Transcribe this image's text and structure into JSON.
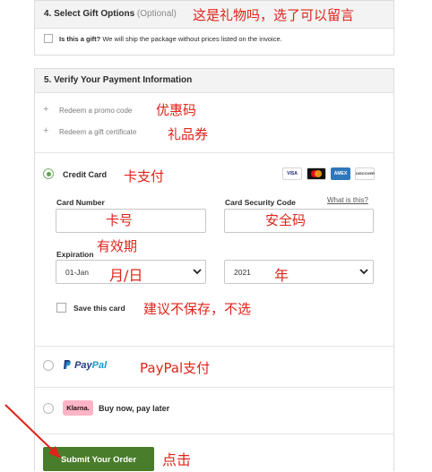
{
  "gift": {
    "heading": "4. Select Gift Options",
    "optional": "(Optional)",
    "annotation": "这是礼物吗，选了可以留言",
    "question": "Is this a gift?",
    "description": " We will ship the package without prices listed on the invoice."
  },
  "payment": {
    "heading": "5. Verify Your Payment Information",
    "promo_label": "Redeem a promo code",
    "promo_annotation": "优惠码",
    "gift_cert_label": "Redeem a gift certificate",
    "gift_cert_annotation": "礼品券",
    "credit_card_label": "Credit Card",
    "credit_card_annotation": "卡支付",
    "card_badges": [
      "VISA",
      "",
      "AMEX",
      "DISCOVER"
    ],
    "card_number_label": "Card Number",
    "card_number_annotation": "卡号",
    "security_code_label": "Card Security Code",
    "what_is_this": "What is this?",
    "security_code_annotation": "安全码",
    "expiration_label": "Expiration",
    "expiration_annotation": "有效期",
    "month_value": "01-Jan",
    "month_annotation": "月/日",
    "year_value": "2021",
    "year_annotation": "年",
    "save_card_label": "Save this card",
    "save_card_annotation": "建议不保存，不选",
    "paypal_brand_1": "Pay",
    "paypal_brand_2": "Pal",
    "paypal_annotation": "PayPal支付",
    "klarna_brand": "Klarna.",
    "klarna_label": "Buy now, pay later",
    "submit_label": "Submit Your Order",
    "submit_annotation": "点击"
  },
  "colors": {
    "annotation": "#e0231a",
    "submit_bg": "#4a7d2b",
    "radio_checked": "#5fa052",
    "paypal_dark": "#253b80",
    "paypal_light": "#179bd7",
    "klarna_pink": "#ffb3c7"
  }
}
